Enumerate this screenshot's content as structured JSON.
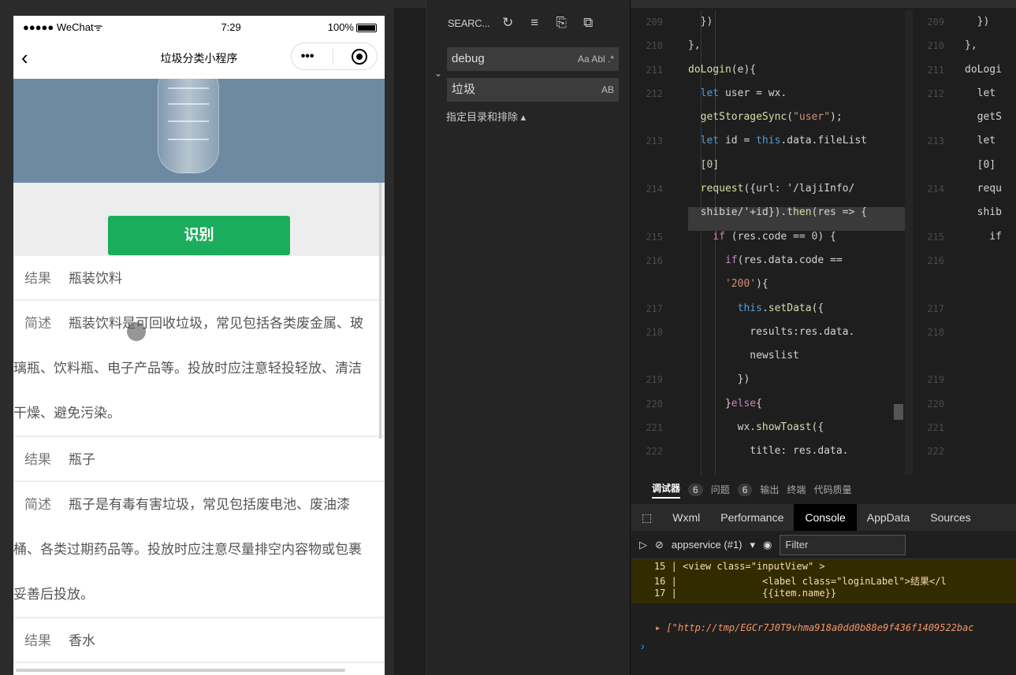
{
  "phone": {
    "status": {
      "carrier": "●●●●● WeChat",
      "wifi": "ᯤ",
      "time": "7:29",
      "battery": "100%"
    },
    "nav": {
      "back": "‹",
      "title": "垃圾分类小程序",
      "more": "•••"
    },
    "recognize_button": "识别",
    "results": [
      {
        "label": "结果",
        "value": "瓶装饮料"
      },
      {
        "label": "简述",
        "lines": [
          "瓶装饮料是可回收垃圾，常见包括各类废金属、玻",
          "璃瓶、饮料瓶、电子产品等。投放时应注意轻投轻放、清洁",
          "干燥、避免污染。"
        ]
      },
      {
        "label": "结果",
        "value": "瓶子"
      },
      {
        "label": "简述",
        "lines": [
          "瓶子是有毒有害垃圾，常见包括废电池、废油漆",
          "桶、各类过期药品等。投放时应注意尽量排空内容物或包裹",
          "妥善后投放。"
        ]
      },
      {
        "label": "结果",
        "value": "香水"
      }
    ]
  },
  "search": {
    "title": "SEARC...",
    "query": "debug",
    "query_opts": "Aa  Abl  .*",
    "replace": "垃圾",
    "replace_opts": "AB",
    "filter_toggle": "指定目录和排除 ▴"
  },
  "editor": {
    "lines": [
      {
        "n": "209",
        "code": "  })"
      },
      {
        "n": "210",
        "code": "},"
      },
      {
        "n": "211",
        "code": "doLogin(e){"
      },
      {
        "n": "212",
        "code": "  let user = wx."
      },
      {
        "n": "",
        "code": "  getStorageSync(\"user\");"
      },
      {
        "n": "213",
        "code": "  let id = this.data.fileList"
      },
      {
        "n": "",
        "code": "  [0]"
      },
      {
        "n": "214",
        "code": "  request({url: '/lajiInfo/"
      },
      {
        "n": "",
        "code": "  shibie/'+id}).then(res => {"
      },
      {
        "n": "215",
        "code": "    if (res.code == 0) {"
      },
      {
        "n": "216",
        "code": "      if(res.data.code =="
      },
      {
        "n": "",
        "code": "      '200'){"
      },
      {
        "n": "217",
        "code": "        this.setData({"
      },
      {
        "n": "218",
        "code": "          results:res.data."
      },
      {
        "n": "",
        "code": "          newslist"
      },
      {
        "n": "219",
        "code": "        })"
      },
      {
        "n": "220",
        "code": "      }else{"
      },
      {
        "n": "221",
        "code": "        wx.showToast({"
      },
      {
        "n": "222",
        "code": "          title: res.data."
      }
    ],
    "right_lines": [
      {
        "n": "209",
        "code": "  })"
      },
      {
        "n": "210",
        "code": "},"
      },
      {
        "n": "211",
        "code": "doLogi"
      },
      {
        "n": "212",
        "code": "  let"
      },
      {
        "n": "",
        "code": "  getS"
      },
      {
        "n": "213",
        "code": "  let"
      },
      {
        "n": "",
        "code": "  [0]"
      },
      {
        "n": "214",
        "code": "  requ"
      },
      {
        "n": "",
        "code": "  shib"
      },
      {
        "n": "215",
        "code": "    if"
      },
      {
        "n": "216",
        "code": ""
      },
      {
        "n": "",
        "code": ""
      },
      {
        "n": "217",
        "code": ""
      },
      {
        "n": "218",
        "code": ""
      },
      {
        "n": "",
        "code": ""
      },
      {
        "n": "219",
        "code": ""
      },
      {
        "n": "220",
        "code": ""
      },
      {
        "n": "221",
        "code": ""
      },
      {
        "n": "222",
        "code": ""
      }
    ]
  },
  "devtools": {
    "tabs": {
      "debugger": "调试器",
      "debugger_count": "6",
      "issues": "问题",
      "issues_count": "6",
      "output": "输出",
      "terminal": "终端",
      "quality": "代码质量"
    },
    "subtabs": [
      "Wxml",
      "Performance",
      "Console",
      "AppData",
      "Sources"
    ],
    "context": "appservice (#1)",
    "filter_placeholder": "Filter",
    "warn_lines": [
      "    15 | <view class=\"inputView\" >",
      "    16 |               <label class=\"loginLabel\">结果</l",
      "    17 |               {{item.name}}"
    ],
    "log": "▸ [\"http://tmp/EGCr7J0T9vhma918a0dd0b88e9f436f1409522bac",
    "prompt": "›"
  }
}
